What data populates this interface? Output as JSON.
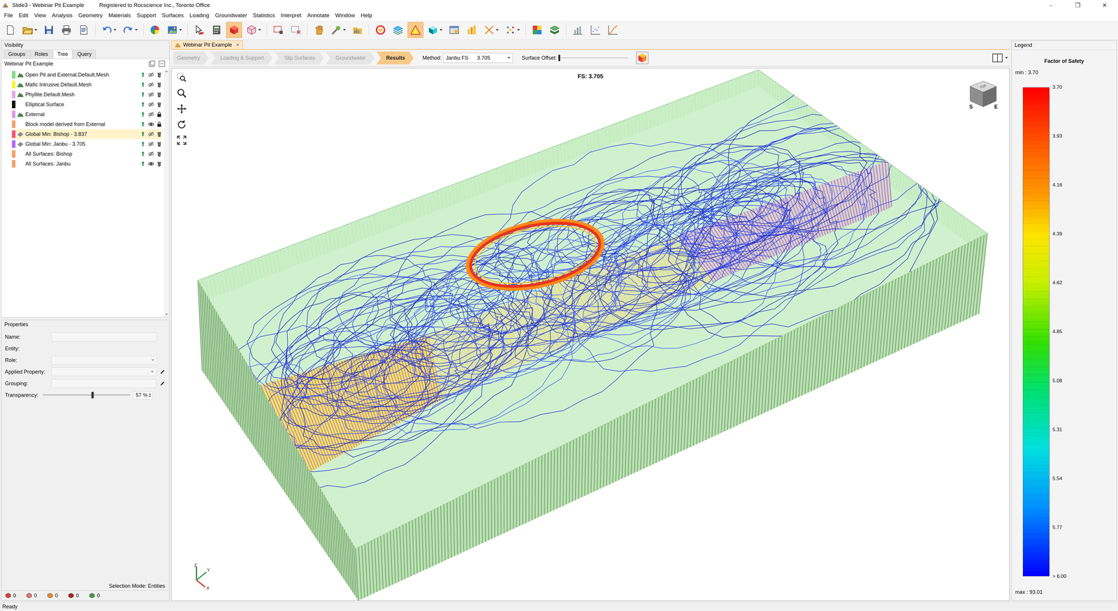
{
  "window": {
    "title": "Slide3 - Webinar Pit Example",
    "registration": "Registered to Rocscience Inc., Toronto Office",
    "controls": [
      "–",
      "❐",
      "✕"
    ]
  },
  "menu": [
    "File",
    "Edit",
    "View",
    "Analysis",
    "Geometry",
    "Materials",
    "Support",
    "Surfaces",
    "Loading",
    "Groundwater",
    "Statistics",
    "Interpret",
    "Annotate",
    "Window",
    "Help"
  ],
  "toolbar": [
    {
      "kind": "button",
      "pressed": false,
      "dropdown": false
    },
    {
      "kind": "button",
      "pressed": false,
      "dropdown": true
    },
    {
      "kind": "button",
      "pressed": false,
      "dropdown": false
    },
    {
      "kind": "button",
      "pressed": false,
      "dropdown": false
    },
    {
      "kind": "button",
      "pressed": false,
      "dropdown": false
    },
    {
      "kind": "separator",
      "pressed": false,
      "dropdown": false
    },
    {
      "kind": "button",
      "pressed": false,
      "dropdown": true
    },
    {
      "kind": "button",
      "pressed": false,
      "dropdown": true
    },
    {
      "kind": "separator",
      "pressed": false,
      "dropdown": false
    },
    {
      "kind": "button",
      "pressed": false,
      "dropdown": false
    },
    {
      "kind": "button",
      "pressed": false,
      "dropdown": true
    },
    {
      "kind": "separator",
      "pressed": false,
      "dropdown": false
    },
    {
      "kind": "button",
      "pressed": false,
      "dropdown": false
    },
    {
      "kind": "button",
      "pressed": false,
      "dropdown": false
    },
    {
      "kind": "button",
      "pressed": true,
      "dropdown": false
    },
    {
      "kind": "button",
      "pressed": false,
      "dropdown": true
    },
    {
      "kind": "separator",
      "pressed": false,
      "dropdown": false
    },
    {
      "kind": "button",
      "pressed": false,
      "dropdown": false
    },
    {
      "kind": "button",
      "pressed": false,
      "dropdown": false
    },
    {
      "kind": "separator",
      "pressed": false,
      "dropdown": false
    },
    {
      "kind": "button",
      "pressed": false,
      "dropdown": false
    },
    {
      "kind": "button",
      "pressed": false,
      "dropdown": true
    },
    {
      "kind": "button",
      "pressed": false,
      "dropdown": false
    },
    {
      "kind": "separator",
      "pressed": false,
      "dropdown": false
    },
    {
      "kind": "button",
      "pressed": false,
      "dropdown": false
    },
    {
      "kind": "button",
      "pressed": false,
      "dropdown": false
    },
    {
      "kind": "button",
      "pressed": true,
      "dropdown": false
    },
    {
      "kind": "button",
      "pressed": false,
      "dropdown": true
    },
    {
      "kind": "button",
      "pressed": false,
      "dropdown": false
    },
    {
      "kind": "button",
      "pressed": false,
      "dropdown": false
    },
    {
      "kind": "button",
      "pressed": false,
      "dropdown": true
    },
    {
      "kind": "button",
      "pressed": false,
      "dropdown": true
    },
    {
      "kind": "separator",
      "pressed": false,
      "dropdown": false
    },
    {
      "kind": "button",
      "pressed": false,
      "dropdown": false
    },
    {
      "kind": "button",
      "pressed": false,
      "dropdown": false
    },
    {
      "kind": "separator",
      "pressed": false,
      "dropdown": false
    },
    {
      "kind": "button",
      "pressed": false,
      "dropdown": false
    },
    {
      "kind": "button",
      "pressed": false,
      "dropdown": false
    },
    {
      "kind": "button",
      "pressed": false,
      "dropdown": false
    }
  ],
  "visibility": {
    "title": "Visibility",
    "tabs": [
      {
        "label": "Groups",
        "selected": false
      },
      {
        "label": "Roles",
        "selected": false
      },
      {
        "label": "Tree",
        "selected": true
      },
      {
        "label": "Query",
        "selected": false
      }
    ],
    "root": "Webinar Pit Example",
    "items": [
      {
        "label": "Open Pit and External.Default.Mesh",
        "color": "#86d986",
        "kind": "mesh",
        "visible": false,
        "locked": false,
        "selected": false
      },
      {
        "label": "Mafic Intrusive.Default.Mesh",
        "color": "#f5f53a",
        "kind": "mesh",
        "visible": false,
        "locked": false,
        "selected": false
      },
      {
        "label": "Phyllite.Default.Mesh",
        "color": "#e7a6e7",
        "kind": "mesh",
        "visible": false,
        "locked": false,
        "selected": false
      },
      {
        "label": "Elliptical Surface",
        "color": "#111111",
        "kind": "plain",
        "visible": false,
        "locked": false,
        "selected": false
      },
      {
        "label": "External",
        "color": "#e39be3",
        "kind": "mesh",
        "visible": false,
        "locked": true,
        "selected": false
      },
      {
        "label": "Block model derived from External",
        "color": "#f4a06a",
        "kind": "plain",
        "visible": true,
        "locked": true,
        "selected": false
      },
      {
        "label": "Global Min: Bishop - 3.837",
        "color": "#ff4d79",
        "kind": "surface",
        "visible": false,
        "locked": false,
        "selected": true
      },
      {
        "label": "Global Min: Janbu - 3.705",
        "color": "#b266ff",
        "kind": "surface",
        "visible": false,
        "locked": false,
        "selected": false
      },
      {
        "label": "All Surfaces: Bishop",
        "color": "#f4a06a",
        "kind": "plain",
        "visible": false,
        "locked": false,
        "selected": false
      },
      {
        "label": "All Surfaces: Janbu",
        "color": "#f4a06a",
        "kind": "plain",
        "visible": true,
        "locked": false,
        "selected": false
      }
    ]
  },
  "properties": {
    "title": "Properties",
    "fields": [
      {
        "label": "Name:",
        "kind": "text"
      },
      {
        "label": "Entity:",
        "kind": "static"
      },
      {
        "label": "Role:",
        "kind": "select"
      },
      {
        "label": "Applied Property:",
        "kind": "select-edit"
      },
      {
        "label": "Grouping:",
        "kind": "text-edit"
      }
    ],
    "transparency": {
      "label": "Transparency:",
      "level": 0.57,
      "value": "57 %"
    },
    "selection_mode": "Selection Mode: Entities",
    "counters": [
      {
        "value": "0",
        "color": "#e23b3b"
      },
      {
        "value": "0",
        "color": "#e57373"
      },
      {
        "value": "0",
        "color": "#f08a24"
      },
      {
        "value": "0",
        "color": "#b71c1c"
      },
      {
        "value": "0",
        "color": "#43a047"
      }
    ]
  },
  "document": {
    "tab": "Webinar Pit Example",
    "close": "×"
  },
  "workflow": [
    {
      "label": "Geometry",
      "selected": false
    },
    {
      "label": "Loading & Support",
      "selected": false
    },
    {
      "label": "Slip Surfaces",
      "selected": false
    },
    {
      "label": "Groundwater",
      "selected": false
    },
    {
      "label": "Results",
      "selected": true
    }
  ],
  "method": {
    "label": "Method:",
    "value": "Janbu FS",
    "reading": "3.705"
  },
  "surface_offset": {
    "label": "Surface Offset:",
    "level": 0
  },
  "viewport": {
    "title": "FS: 3.705",
    "nav_cube": {
      "top": "TOP",
      "south": "S",
      "east": "E"
    },
    "axes": [
      "Z",
      "Y",
      "X"
    ]
  },
  "legend": {
    "title": "Legend",
    "heading": "Factor of Safety",
    "min": "min : 3.70",
    "ticks": [
      "3.70",
      "3.93",
      "4.16",
      "4.39",
      "4.62",
      "4.85",
      "5.08",
      "5.31",
      "5.54",
      "5.77",
      "> 6.00"
    ],
    "max": "max : 93.01"
  },
  "status_bar": "Ready"
}
